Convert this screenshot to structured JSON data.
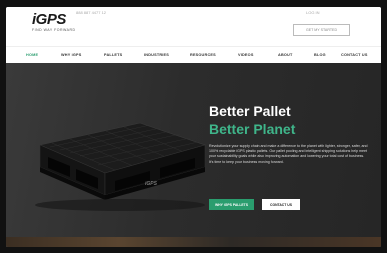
{
  "header": {
    "logo_text": "iGPS",
    "logo_tagline": "FIND WAY FORWARD",
    "top_left_faint": "888 887 4477 12",
    "top_right_faint": "LOG IN",
    "cta_label": "GET MY STARTED"
  },
  "nav": {
    "items": [
      {
        "label": "HOME",
        "active": true
      },
      {
        "label": "WHY iGPS",
        "active": false
      },
      {
        "label": "PALLETS",
        "active": false
      },
      {
        "label": "INDUSTRIES",
        "active": false
      },
      {
        "label": "RESOURCES",
        "active": false
      },
      {
        "label": "VIDEOS",
        "active": false
      },
      {
        "label": "ABOUT",
        "active": false
      },
      {
        "label": "BLOG",
        "active": false
      },
      {
        "label": "CONTACT US",
        "active": false
      }
    ]
  },
  "hero": {
    "title_line1": "Better Pallet",
    "title_line2": "Better Planet",
    "body": "Revolutionize your supply chain and make a difference to the planet with lighter, stronger, safer, and 100% recyclable iGPS plastic pallets. Our pallet pooling and intelligent shipping solutions help meet your sustainability goals while also improving automation and lowering your total cost of business. It's time to keep your business moving forward.",
    "primary_button": "WHY iGPS PALLETS",
    "secondary_button": "CONTACT US",
    "pallet_logo": "iGPS"
  },
  "colors": {
    "accent": "#2a9d6e",
    "accent_text": "#3fb58a",
    "hero_bg": "#2c2c2c"
  }
}
